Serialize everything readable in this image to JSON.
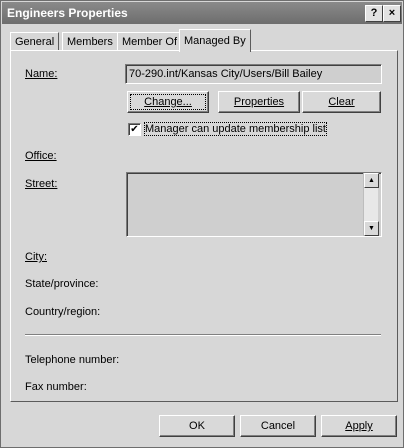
{
  "window": {
    "title": "Engineers Properties"
  },
  "titlebar": {
    "help": "?",
    "close": "×"
  },
  "tabs": [
    {
      "label": "General"
    },
    {
      "label": "Members"
    },
    {
      "label": "Member Of"
    },
    {
      "label": "Managed By"
    }
  ],
  "form": {
    "name_label": "Name:",
    "name_value": "70-290.int/Kansas City/Users/Bill Bailey",
    "change_label": "Change...",
    "properties_label": "Properties",
    "clear_label": "Clear",
    "manager_checkbox_label": "Manager can update membership list",
    "manager_checked": "✔",
    "office_label": "Office:",
    "street_label": "Street:",
    "city_label": "City:",
    "state_label": "State/province:",
    "country_label": "Country/region:",
    "telephone_label": "Telephone number:",
    "fax_label": "Fax number:"
  },
  "footer": {
    "ok": "OK",
    "cancel": "Cancel",
    "apply": "Apply"
  }
}
